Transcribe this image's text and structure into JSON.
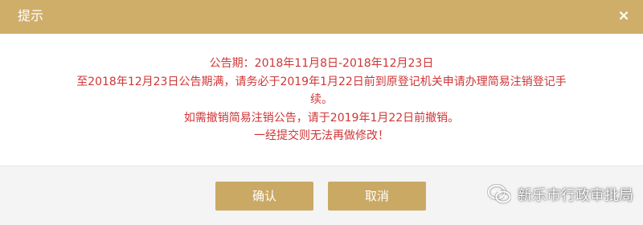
{
  "dialog": {
    "title": "提示",
    "close_glyph": "×",
    "message_lines": [
      "公告期：2018年11月8日-2018年12月23日",
      "至2018年12月23日公告期满，请务必于2019年1月22日前到原登记机关申请办理简易注销登记手",
      "续。",
      "如需撤销简易注销公告，请于2019年1月22日前撤销。",
      "一经提交则无法再做修改！"
    ],
    "buttons": {
      "confirm": "确认",
      "cancel": "取消"
    }
  },
  "watermark": {
    "text": "新乐市行政审批局",
    "icon": "wechat-icon"
  },
  "colors": {
    "titlebar": "#cfae6a",
    "button": "#c9a964",
    "message_text": "#d03536"
  }
}
